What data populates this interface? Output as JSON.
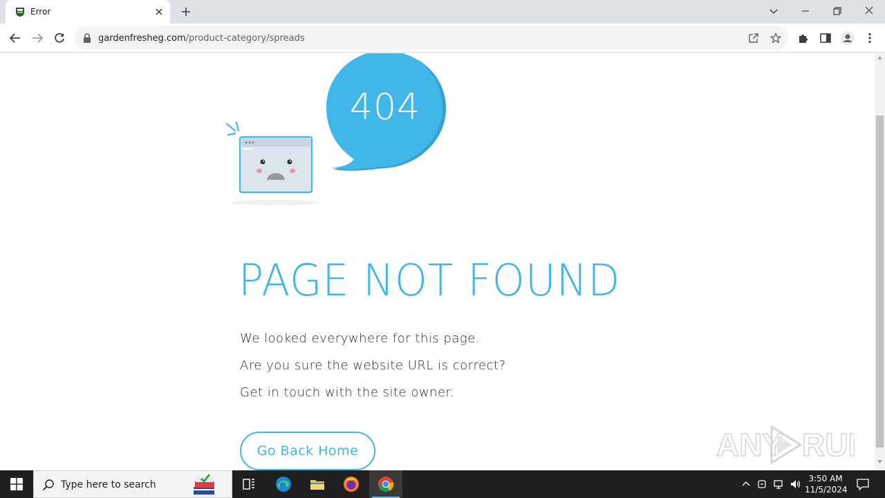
{
  "browser": {
    "tab": {
      "title": "Error"
    },
    "url": {
      "host": "gardenfresheg.com",
      "path": "/product-category/spreads"
    }
  },
  "page": {
    "code": "404",
    "headline": "PAGE NOT FOUND",
    "messages": [
      "We looked everywhere for this page.",
      "Are you sure the website URL is correct?",
      "Get in touch with the site owner."
    ],
    "home_button": "Go Back Home",
    "accent_color": "#3fb6e6"
  },
  "watermark": {
    "text": "ANY RUN"
  },
  "taskbar": {
    "search_placeholder": "Type here to search",
    "time": "3:50 AM",
    "date": "11/5/2024"
  }
}
